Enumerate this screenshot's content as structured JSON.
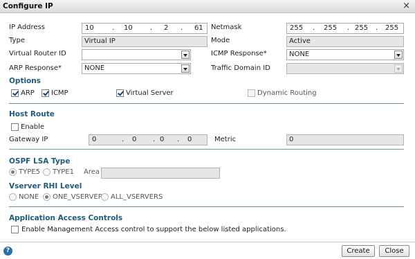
{
  "window": {
    "title": "Configure IP"
  },
  "fields": {
    "ip_address": {
      "label": "IP Address",
      "segments": [
        "10",
        "10",
        "2",
        "61"
      ]
    },
    "netmask": {
      "label": "Netmask",
      "segments": [
        "255",
        "255",
        "255",
        "255"
      ]
    },
    "type": {
      "label": "Type",
      "value": "Virtual IP"
    },
    "mode": {
      "label": "Mode",
      "value": "Active"
    },
    "virtual_router_id": {
      "label": "Virtual Router ID",
      "value": ""
    },
    "icmp_response": {
      "label": "ICMP Response*",
      "value": "NONE"
    },
    "arp_response": {
      "label": "ARP Response*",
      "value": "NONE"
    },
    "traffic_domain_id": {
      "label": "Traffic Domain ID",
      "value": ""
    }
  },
  "options": {
    "heading": "Options",
    "arp": "ARP",
    "icmp": "ICMP",
    "virtual_server": "Virtual Server",
    "dynamic_routing": "Dynamic Routing"
  },
  "host_route": {
    "heading": "Host Route",
    "enable": "Enable",
    "gateway_label": "Gateway IP",
    "gateway_segments": [
      "0",
      "0",
      "0",
      "0"
    ],
    "metric_label": "Metric",
    "metric_value": "0"
  },
  "ospf": {
    "heading": "OSPF LSA Type",
    "type5": "TYPE5",
    "type1": "TYPE1",
    "area_label": "Area",
    "area_value": ""
  },
  "vserver_rhi": {
    "heading": "Vserver RHI Level",
    "none": "NONE",
    "one_vserver": "ONE_VSERVER",
    "all_vservers": "ALL_VSERVERS"
  },
  "app_access": {
    "heading": "Application Access Controls",
    "enable_label": "Enable Management Access control to support the below listed applications."
  },
  "footer": {
    "help": "?",
    "create": "Create",
    "close": "Close"
  },
  "icons": {
    "close": "close-icon",
    "help": "help-icon"
  },
  "colors": {
    "section_heading": "#1f5a7a",
    "rule": "#6f98ad",
    "help_icon": "#2a6fb0"
  }
}
